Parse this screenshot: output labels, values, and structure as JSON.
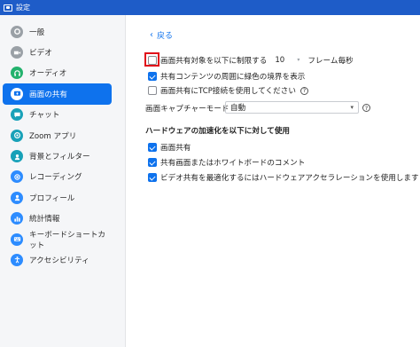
{
  "window": {
    "title": "設定"
  },
  "sidebar": {
    "items": [
      {
        "label": "一般",
        "icon": "gear-icon"
      },
      {
        "label": "ビデオ",
        "icon": "video-camera-icon"
      },
      {
        "label": "オーディオ",
        "icon": "headphones-icon"
      },
      {
        "label": "画面の共有",
        "icon": "share-screen-icon",
        "active": true
      },
      {
        "label": "チャット",
        "icon": "chat-bubble-icon"
      },
      {
        "label": "Zoom アプリ",
        "icon": "zoom-apps-icon"
      },
      {
        "label": "背景とフィルター",
        "icon": "background-filter-icon"
      },
      {
        "label": "レコーディング",
        "icon": "record-icon"
      },
      {
        "label": "プロフィール",
        "icon": "profile-icon"
      },
      {
        "label": "統計情報",
        "icon": "statistics-icon"
      },
      {
        "label": "キーボードショートカット",
        "icon": "keyboard-icon"
      },
      {
        "label": "アクセシビリティ",
        "icon": "accessibility-icon"
      }
    ]
  },
  "main": {
    "back_label": "戻る",
    "limit": {
      "label": "画面共有対象を以下に制限する",
      "value": "10",
      "unit": "フレーム毎秒",
      "checked": false
    },
    "green_border": {
      "label": "共有コンテンツの周囲に緑色の境界を表示",
      "checked": true
    },
    "tcp": {
      "label": "画面共有にTCP接続を使用してください",
      "checked": false
    },
    "capture_mode": {
      "label": "画面キャプチャーモード",
      "value": "自動"
    },
    "hw_section": {
      "title": "ハードウェアの加速化を以下に対して使用",
      "items": [
        {
          "label": "画面共有",
          "checked": true
        },
        {
          "label": "共有画面またはホワイトボードのコメント",
          "checked": true
        },
        {
          "label": "ビデオ共有を最適化するにはハードウェアアクセラレーションを使用します",
          "checked": true
        }
      ]
    }
  },
  "colors": {
    "accent": "#0e72ed",
    "titlebar": "#1e5cc8",
    "highlight": "#e0101a"
  }
}
